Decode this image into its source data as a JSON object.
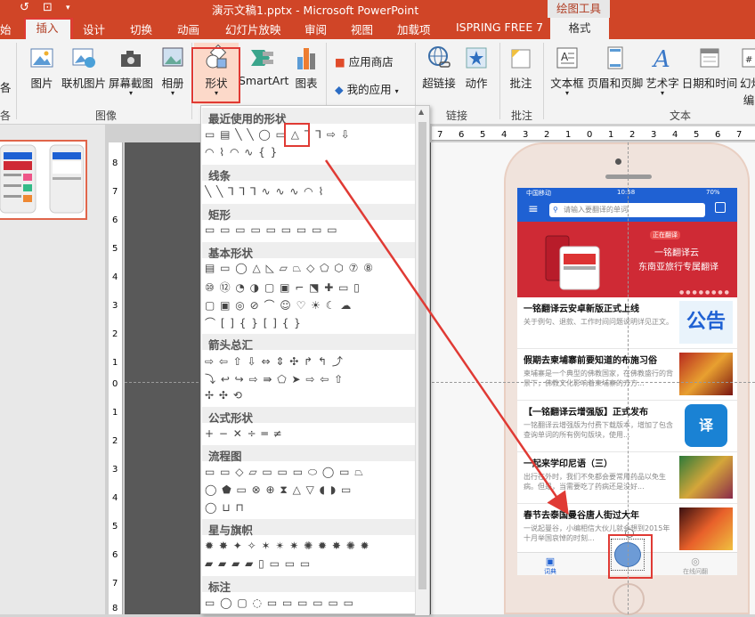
{
  "window": {
    "title": "演示文稿1.pptx - Microsoft PowerPoint",
    "contextual_tools": "绘图工具"
  },
  "tabs": [
    "始",
    "插入",
    "设计",
    "切换",
    "动画",
    "幻灯片放映",
    "审阅",
    "视图",
    "加载项",
    "ISPRING FREE 7",
    "格式"
  ],
  "ribbon": {
    "left_cut_label": "各",
    "buttons": {
      "picture": "图片",
      "online_picture": "联机图片",
      "screenshot": "屏幕截图",
      "album": "相册",
      "shapes": "形状",
      "smartart": "SmartArt",
      "chart": "图表",
      "store": "应用商店",
      "my_apps": "我的应用",
      "hyperlink": "超链接",
      "action": "动作",
      "comment": "批注",
      "textbox": "文本框",
      "header_footer": "页眉和页脚",
      "wordart": "艺术字",
      "datetime": "日期和时间",
      "slide_number": "幻灯",
      "slide_number_2": "编"
    },
    "groups": {
      "left_cut": "各",
      "images": "图像",
      "links": "链接",
      "comments": "批注",
      "text": "文本"
    }
  },
  "shapes_gallery": {
    "categories": [
      "最近使用的形状",
      "线条",
      "矩形",
      "基本形状",
      "箭头总汇",
      "公式形状",
      "流程图",
      "星与旗帜",
      "标注"
    ],
    "rows": {
      "recent_1": "▭ ▤ ╲ ╲ ◯ ▭ △ ⅂ ⅂ ⇨ ⇩",
      "recent_2": "◠ ⌇ ◠ ∿ { }",
      "lines": "╲ ╲ ⅂ ⅂ ⅂ ∿ ∿ ∿ ◠ ⌇",
      "rect": "▭ ▭ ▭ ▭ ▭ ▭ ▭ ▭ ▭",
      "basic_1": "▤ ▭ ◯ △ ◺ ▱ ⏢ ◇ ⬠ ⬡ ⑦ ⑧",
      "basic_2": "⑩ ⑫ ◔ ◑ ▢ ▣ ⌐ ⬔ ✚ ▭ ▯",
      "basic_3": "▢ ▣ ◎ ⊘ ⌒ ☺ ♡ ☀ ☾ ☁",
      "basic_4": "⌒ [ ] { } [ ] { }",
      "arrow_1": "⇨ ⇦ ⇧ ⇩ ⇔ ⇕ ✣ ↱ ↰ ⤴",
      "arrow_2": "⤵ ↩ ↪ ⇨ ⇛ ⬠ ➤ ⇨ ⇦ ⇧",
      "arrow_3": "✢ ✣ ⟲",
      "equation": "+ − ✕ ÷ ═ ≠",
      "flow_1": "▭ ▭ ◇ ▱ ▭ ▭ ▭ ⬭ ◯ ▭ ⏢",
      "flow_2": "◯ ⬟ ▭ ⊗ ⊕ ⧗ △ ▽ ◖ ◗ ▭",
      "flow_3": "◯ ⊔ ⊓",
      "stars_1": "✹ ✸ ✦ ✧ ✶ ✴ ✷ ✺ ✹ ✸ ✺ ✹",
      "stars_2": "▰ ▰ ▰ ▰ ▯ ▭ ▭ ▭",
      "callouts": "▭ ◯ ▢ ◌ ▭ ▭ ▭ ▭ ▭ ▭"
    }
  },
  "ruler": {
    "top": [
      "7",
      "6",
      "5",
      "4",
      "3",
      "2",
      "1",
      "0",
      "1",
      "2",
      "3",
      "4",
      "5",
      "6",
      "7"
    ],
    "left": [
      "8",
      "7",
      "6",
      "5",
      "4",
      "3",
      "2",
      "1",
      "0",
      "1",
      "2",
      "3",
      "4",
      "5",
      "6",
      "7",
      "8"
    ]
  },
  "phone_app": {
    "status_carrier": "中国移动",
    "status_time": "10:58",
    "status_battery": "70%",
    "search_placeholder": "请输入要翻译的单词",
    "banner_line1": "一铭翻译云",
    "banner_line2": "东南亚旅行专属翻译",
    "banner_tag": "正在翻译",
    "news": [
      {
        "title": "一铭翻译云安卓新版正式上线",
        "desc": "关于例句、退款、工作时间问题说明详见正文。",
        "img": "公告"
      },
      {
        "title": "假期去柬埔寨前要知道的布施习俗",
        "desc": "柬埔寨是一个典型的佛教国家，在佛教盛行的背景下，佛教文化影响着柬埔寨的方方...",
        "img": ""
      },
      {
        "title": "【一铭翻译云增强版】正式发布",
        "desc": "一铭翻译云增强版为付费下载版本，增加了包含查询单词的所有例句版块，使用...",
        "img": "译"
      },
      {
        "title": "一起来学印尼语（三）",
        "desc": "出行在外时，我们不免都会要常用药品以免生病。但是，当需要吃了药病还是没好...",
        "img": ""
      },
      {
        "title": "春节去泰国曼谷唐人街过大年",
        "desc": "一说起曼谷，小编相信大伙儿就会想到2015年十月举国哀悼的时刻...",
        "img": ""
      }
    ],
    "tabbar": [
      "词典",
      "",
      "在线问翻"
    ]
  },
  "colors": {
    "ribbon_accent": "#d04527",
    "highlight": "#e03a34",
    "app_blue": "#1f61d3",
    "banner_red": "#cf2a35"
  }
}
